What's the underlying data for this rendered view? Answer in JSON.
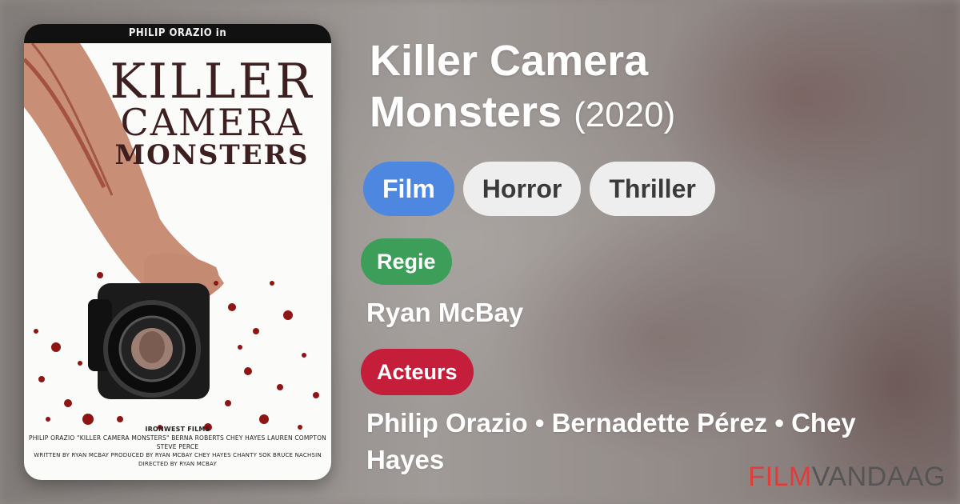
{
  "poster": {
    "top_credit": "PHILIP ORAZIO in",
    "title_line1": "KILLER",
    "title_line2": "CAMERA",
    "title_line3": "MONSTERS",
    "studio": "IRONWEST FILMS",
    "credits_line1": "PHILIP ORAZIO \"KILLER CAMERA MONSTERS\" BERNA ROBERTS CHEY HAYES LAUREN COMPTON STEVE PERCE",
    "credits_line2": "WRITTEN BY RYAN MCBAY  PRODUCED BY RYAN MCBAY CHEY HAYES CHANTY SOK BRUCE NACHSIN",
    "credits_line3": "DIRECTED BY RYAN MCBAY"
  },
  "movie": {
    "title_line1": "Killer Camera",
    "title_line2": "Monsters",
    "year": "(2020)"
  },
  "tags": [
    "Film",
    "Horror",
    "Thriller"
  ],
  "sections": {
    "director_label": "Regie",
    "director": "Ryan McBay",
    "cast_label": "Acteurs",
    "cast": "Philip Orazio • Bernadette Pérez • Chey Hayes"
  },
  "brand": {
    "part1": "FILM",
    "part2": "VANDAAG"
  },
  "colors": {
    "film_tag": "#4d87e0",
    "genre_tag": "#eeeeee",
    "regie_badge": "#3d9e5a",
    "acteurs_badge": "#c41e3a",
    "brand_accent": "#e23b3b"
  }
}
